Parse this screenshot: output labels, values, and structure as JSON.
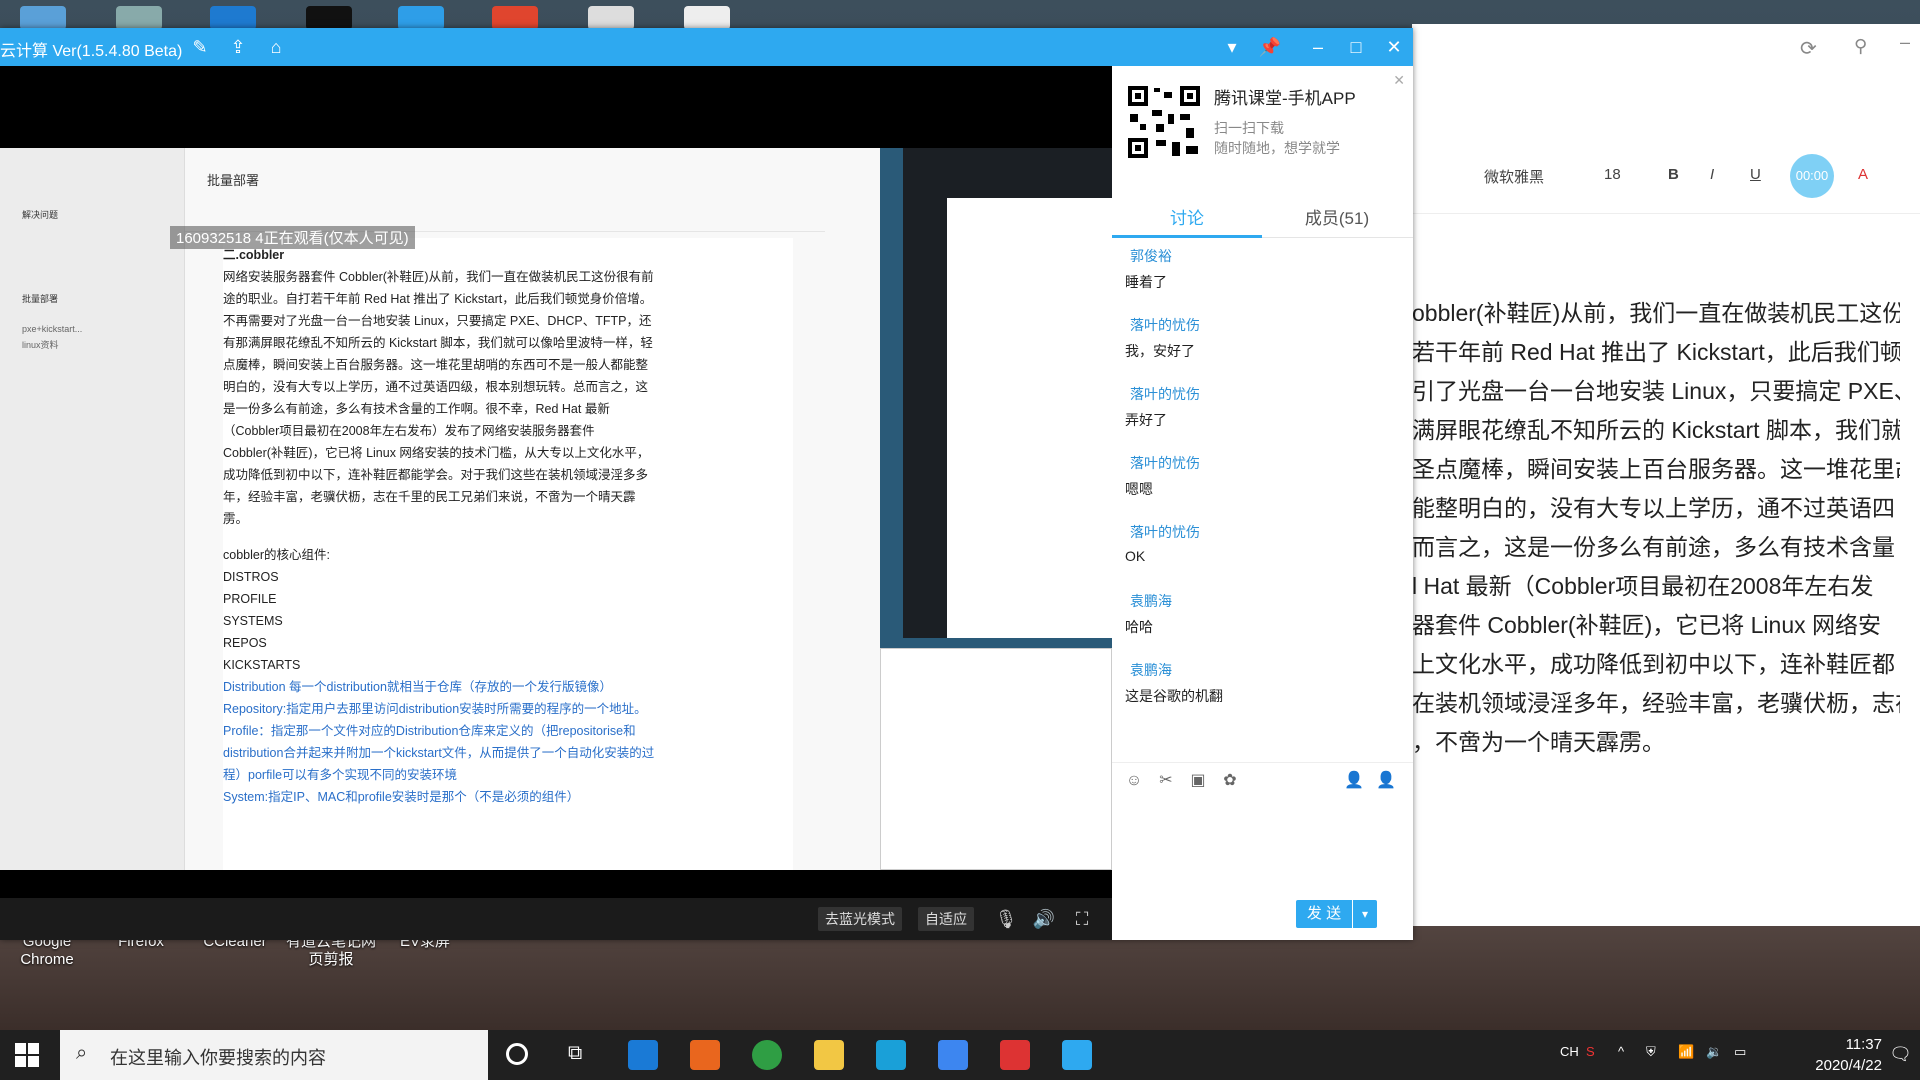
{
  "desktop": {
    "icons": [
      "Google Chrome",
      "Firefox",
      "CCleaner",
      "有道云笔记网页剪报",
      "EV录屏"
    ]
  },
  "app": {
    "title": "云计算 Ver(1.5.4.80 Beta)",
    "controls": {
      "mode_label": "去蓝光模式",
      "fit_label": "自适应"
    }
  },
  "shared_screen": {
    "watermark": "160932518 4正在观看(仅本人可见)",
    "doc_title": "批量部署",
    "heading": "二.cobbler",
    "paragraph": [
      "网络安装服务器套件 Cobbler(补鞋匠)从前，我们一直在做装机民工这份很有前",
      "途的职业。自打若干年前 Red Hat 推出了 Kickstart，此后我们顿觉身价倍增。",
      "不再需要对了光盘一台一台地安装 Linux，只要搞定 PXE、DHCP、TFTP，还",
      "有那满屏眼花缭乱不知所云的 Kickstart 脚本，我们就可以像哈里波特一样，轻",
      "点魔棒，瞬间安装上百台服务器。这一堆花里胡哨的东西可不是一般人都能整",
      "明白的，没有大专以上学历，通不过英语四级，根本别想玩转。总而言之，这",
      "是一份多么有前途，多么有技术含量的工作啊。很不幸，Red Hat 最新",
      "（Cobbler项目最初在2008年左右发布）发布了网络安装服务器套件",
      "Cobbler(补鞋匠)，它已将 Linux 网络安装的技术门槛，从大专以上文化水平，",
      "成功降低到初中以下，连补鞋匠都能学会。对于我们这些在装机领域浸淫多多",
      "年，经验丰富，老骥伏枥，志在千里的民工兄弟们来说，不啻为一个晴天霹",
      "雳。"
    ],
    "components_title": "cobbler的核心组件:",
    "components": [
      "DISTROS",
      "PROFILE",
      "SYSTEMS",
      "REPOS",
      "KICKSTARTS"
    ],
    "notes": [
      "Distribution  每一个distribution就相当于仓库（存放的一个发行版镜像）",
      "Repository:指定用户去那里访问distribution安装时所需要的程序的一个地址。",
      "Profile：指定那一个文件对应的Distribution仓库来定义的（把repositorise和",
      "distribution合并起来并附加一个kickstart文件，从而提供了一个自动化安装的过",
      "程）porfile可以有多个实现不同的安装环境",
      "System:指定IP、MAC和profile安装时是那个（不是必须的组件）"
    ],
    "sidebar": [
      "解决问题",
      "批量部署",
      "pxe+kickstart...",
      "linux资料"
    ]
  },
  "side": {
    "promo": {
      "title": "腾讯课堂-手机APP",
      "line1": "扫一扫下载",
      "line2": "随时随地，想学就学"
    },
    "tabs": [
      "讨论",
      "成员(51)"
    ],
    "messages": [
      {
        "name": "郭俊裕",
        "text": "睡着了"
      },
      {
        "name": "落叶的忧伤",
        "text": "我，安好了"
      },
      {
        "name": "落叶的忧伤",
        "text": "弄好了"
      },
      {
        "name": "落叶的忧伤",
        "text": "嗯嗯"
      },
      {
        "name": "落叶的忧伤",
        "text": "OK"
      },
      {
        "name": "袁鹏海",
        "text": "哈哈"
      },
      {
        "name": "袁鹏海",
        "text": "这是谷歌的机翻"
      }
    ],
    "send_label": "发 送"
  },
  "doc_window": {
    "font": "微软雅黑",
    "size": "18",
    "timer": "00:00",
    "lines": [
      "obbler(补鞋匠)从前，我们一直在做装机民工这份",
      "若干年前 Red Hat 推出了 Kickstart，此后我们顿",
      "引了光盘一台一台地安装 Linux，只要搞定 PXE、",
      "满屏眼花缭乱不知所云的 Kickstart 脚本，我们就",
      "圣点魔棒，瞬间安装上百台服务器。这一堆花里胡",
      "能整明白的，没有大专以上学历，通不过英语四",
      "而言之，这是一份多么有前途，多么有技术含量",
      "l Hat 最新（Cobbler项目最初在2008年左右发",
      "器套件 Cobbler(补鞋匠)，它已将 Linux 网络安",
      "上文化水平，成功降低到初中以下，连补鞋匠都",
      "在装机领域浸淫多年，经验丰富，老骥伏枥，志在",
      "，不啻为一个晴天霹雳。"
    ]
  },
  "taskbar": {
    "search_placeholder": "在这里输入你要搜索的内容",
    "ime": "CH",
    "time": "11:37",
    "date": "2020/4/22"
  }
}
